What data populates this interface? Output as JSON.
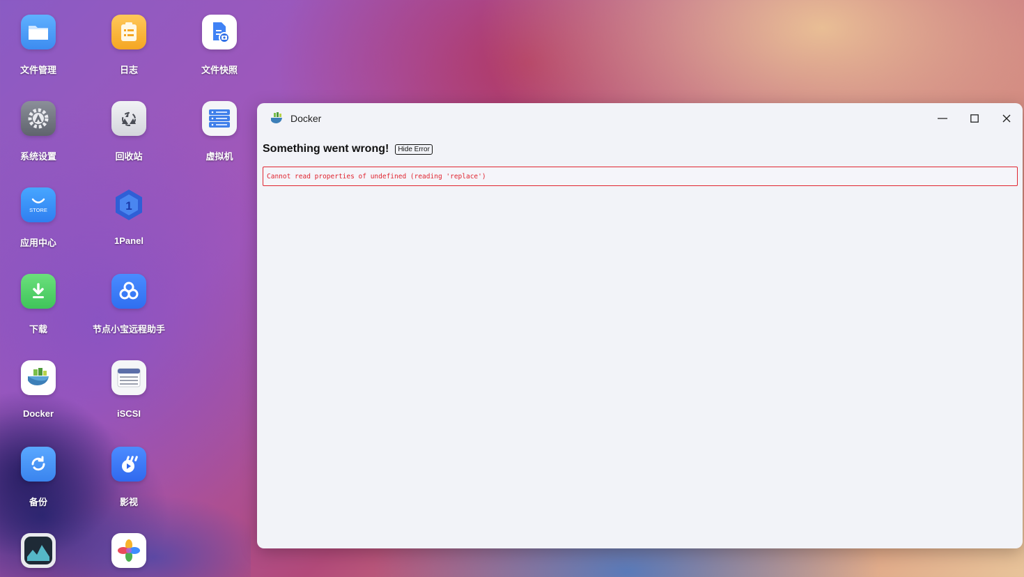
{
  "desktop": {
    "icons": [
      {
        "label": "文件管理",
        "icon": "folder-icon"
      },
      {
        "label": "日志",
        "icon": "log-icon"
      },
      {
        "label": "文件快照",
        "icon": "file-snapshot-icon"
      },
      {
        "label": "系统设置",
        "icon": "gear-icon"
      },
      {
        "label": "回收站",
        "icon": "recycle-bin-icon"
      },
      {
        "label": "虚拟机",
        "icon": "virtual-machine-icon"
      },
      {
        "label": "应用中心",
        "icon": "store-icon",
        "badge": "STORE"
      },
      {
        "label": "1Panel",
        "icon": "1panel-icon",
        "badge": "1"
      },
      {
        "label": "下载",
        "icon": "download-icon"
      },
      {
        "label": "节点小宝远程助手",
        "icon": "remote-helper-icon"
      },
      {
        "label": "Docker",
        "icon": "docker-icon"
      },
      {
        "label": "iSCSI",
        "icon": "iscsi-icon"
      },
      {
        "label": "备份",
        "icon": "backup-icon"
      },
      {
        "label": "影视",
        "icon": "video-icon"
      },
      {
        "label": "",
        "icon": "monitor-icon"
      },
      {
        "label": "",
        "icon": "photos-icon"
      }
    ]
  },
  "window": {
    "title": "Docker",
    "error_title": "Something went wrong!",
    "hide_error_label": "Hide Error",
    "error_message": "Cannot read properties of undefined (reading 'replace')"
  },
  "colors": {
    "error_red": "#e0242f",
    "window_bg": "#f2f3f8"
  }
}
